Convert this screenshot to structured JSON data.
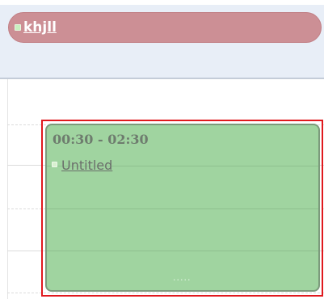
{
  "all_day_event": {
    "title": "khjll",
    "color": "#cc8f95"
  },
  "timed_event": {
    "time_range": "00:30 - 02:30",
    "title": "Untitled",
    "color": "#a0d4a0",
    "selected": true,
    "selection_color": "#e0191e",
    "resize_handle": "....."
  }
}
